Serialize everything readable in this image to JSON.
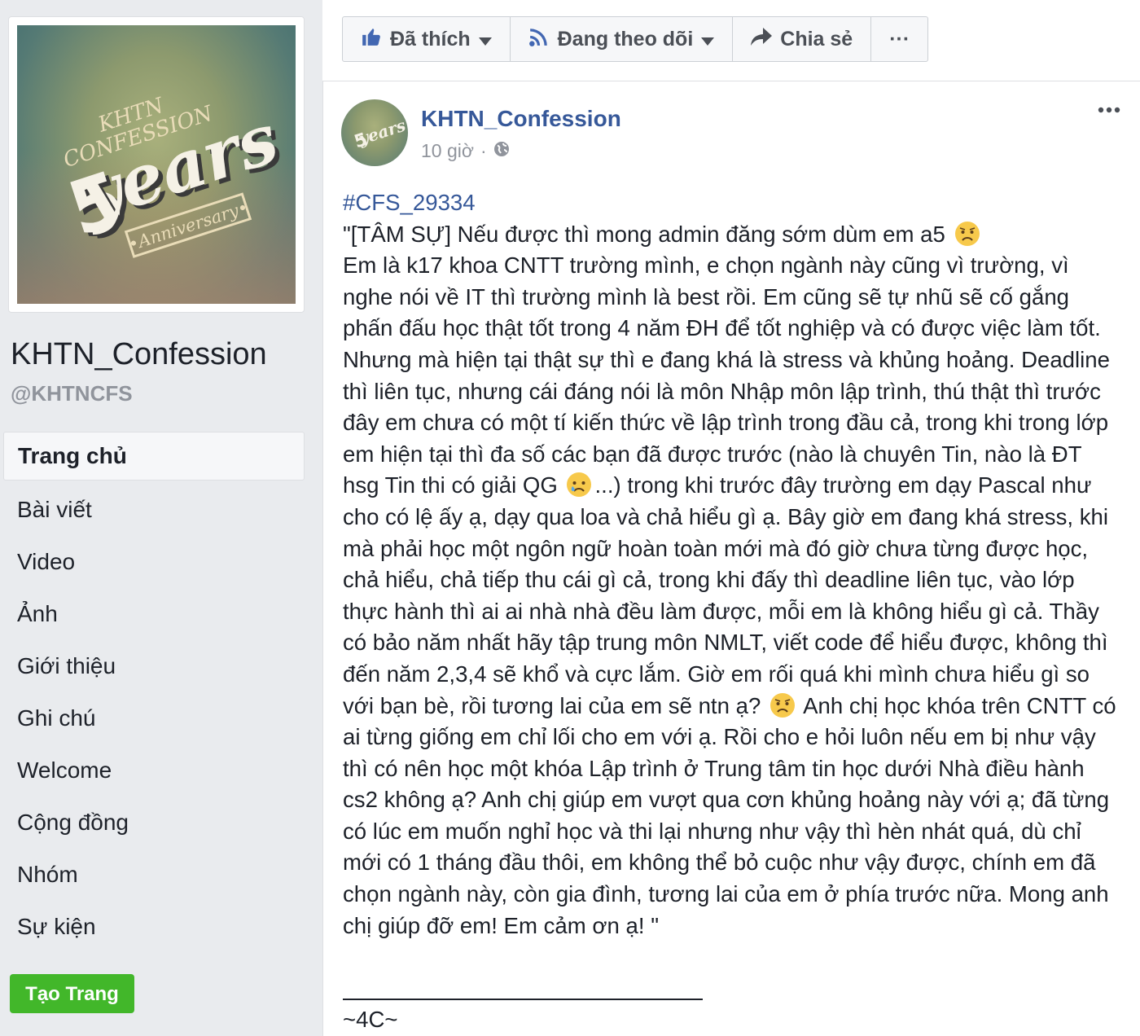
{
  "sidebar": {
    "page_name": "KHTN_Confession",
    "handle": "@KHTNCFS",
    "profile_art": {
      "top_text": "KHTN",
      "mid_text": "CONFESSION",
      "big_number": "5",
      "big_word": "years",
      "ribbon_text": "•Anniversary•"
    },
    "nav": [
      {
        "label": "Trang chủ",
        "active": true
      },
      {
        "label": "Bài viết"
      },
      {
        "label": "Video"
      },
      {
        "label": "Ảnh"
      },
      {
        "label": "Giới thiệu"
      },
      {
        "label": "Ghi chú"
      },
      {
        "label": "Welcome"
      },
      {
        "label": "Cộng đồng"
      },
      {
        "label": "Nhóm"
      },
      {
        "label": "Sự kiện"
      }
    ],
    "create_page_label": "Tạo Trang"
  },
  "actions": {
    "liked_label": "Đã thích",
    "following_label": "Đang theo dõi",
    "share_label": "Chia sẻ",
    "more_label": "···"
  },
  "post": {
    "author": "KHTN_Confession",
    "time": "10 giờ",
    "separator": "·",
    "hashtag": "#CFS_29334",
    "p1": "\"[TÂM SỰ] Nếu được thì mong admin đăng sớm dùm em a5",
    "p2": "Em là k17 khoa CNTT trường mình, e chọn ngành này cũng vì trường, vì nghe nói về IT thì trường mình là best rồi. Em cũng sẽ tự nhũ sẽ cố gắng phấn đấu học thật tốt trong 4 năm ĐH để tốt nghiệp và có được việc làm tốt. Nhưng mà hiện tại thật sự thì e đang khá là stress và khủng hoảng. Deadline thì liên tục, nhưng cái đáng nói là môn Nhập môn lập trình, thú thật thì trước đây em chưa có một tí kiến thức về lập trình trong đầu cả, trong khi trong lớp em hiện tại thì đa số các bạn đã được trước (nào là chuyên Tin, nào là ĐT hsg Tin thi có giải QG",
    "p3": "...) trong khi trước đây trường em dạy Pascal như cho có lệ ấy ạ, dạy qua loa và chả hiểu gì ạ. Bây giờ em đang khá stress, khi mà phải học một ngôn ngữ hoàn toàn mới mà đó giờ chưa từng được học, chả hiểu, chả tiếp thu cái gì cả, trong khi đấy thì deadline liên tục, vào lớp thực hành thì ai ai nhà nhà đều làm được, mỗi em là không hiểu gì cả. Thầy có bảo năm nhất hãy tập trung môn NMLT, viết code để hiểu được, không thì đến năm 2,3,4 sẽ khổ và cực lắm. Giờ em rối quá khi mình chưa hiểu gì so với bạn bè, rồi tương lai của em sẽ ntn ạ?",
    "p4": "Anh chị học khóa trên CNTT có ai từng giống em chỉ lối cho em với ạ. Rồi cho e hỏi luôn nếu em bị như vậy thì có nên học một khóa Lập trình ở Trung tâm tin học dưới Nhà điều hành cs2 không ạ? Anh chị giúp em vượt qua cơn khủng hoảng này với ạ; đã từng có lúc em muốn nghỉ học và thi lại nhưng như vậy thì hèn nhát quá, dù chỉ mới có 1 tháng đầu thôi, em không thể bỏ cuộc như vậy được, chính em đã chọn ngành này, còn gia đình, tương lai của em ở phía trước nữa. Mong anh chị giúp đỡ em! Em cảm ơn ạ! \"",
    "signature": "~4C~"
  },
  "colors": {
    "link": "#365899",
    "green": "#42b72a",
    "muted": "#90949c",
    "bg": "#e9ebee"
  },
  "icons": [
    "like-icon",
    "rss-icon",
    "share-arrow-icon",
    "more-icon",
    "globe-icon",
    "sad-emoji-icon",
    "crying-emoji-icon",
    "caret-down-icon"
  ]
}
